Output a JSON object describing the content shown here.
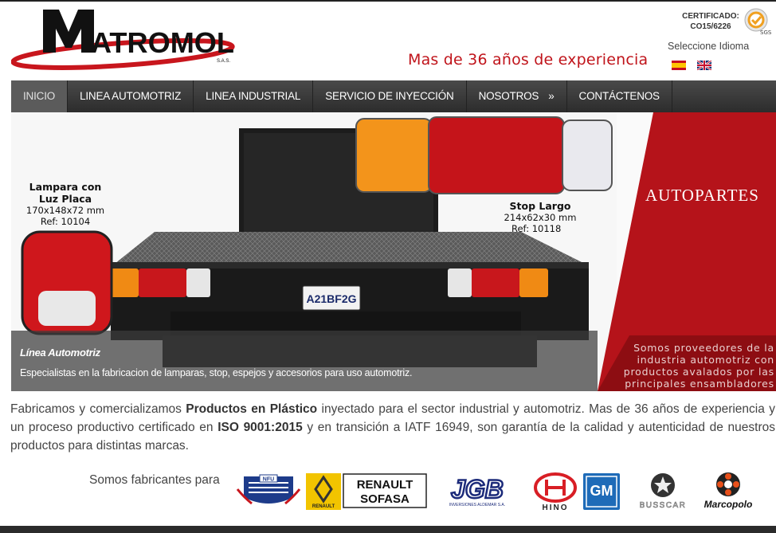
{
  "header": {
    "logo_text": "MATROMOL",
    "logo_sub": "S.A.S.",
    "tagline": "Mas de 36 años de experiencia",
    "cert_label": "CERTIFICADO:",
    "cert_code": "CO15/6226",
    "cert_badge_text": "SGS",
    "language_label": "Seleccione Idioma",
    "flags": [
      "spanish-flag",
      "english-flag"
    ]
  },
  "nav": {
    "items": [
      {
        "label": "INICIO"
      },
      {
        "label": "LINEA AUTOMOTRIZ"
      },
      {
        "label": "LINEA INDUSTRIAL"
      },
      {
        "label": "SERVICIO DE INYECCIÓN"
      },
      {
        "label": "NOSOTROS",
        "arrow": "»"
      },
      {
        "label": "CONTÁCTENOS"
      }
    ]
  },
  "banner": {
    "left_product": {
      "title1": "Lampara con",
      "title2": "Luz Placa",
      "size": "170x148x72 mm",
      "ref": "Ref: 10104"
    },
    "right_product": {
      "title": "Stop Largo",
      "size": "214x62x30 mm",
      "ref": "Ref: 10118"
    },
    "plate": "A21BF2G",
    "red_title": "AUTOPARTES",
    "red_caption": "Somos proveedores de la industria automotriz con productos avalados por las principales ensambladores",
    "caption_title": "Línea Automotriz",
    "caption_text": "Especialistas en la fabricacion de lamparas, stop, espejos y accesorios para uso automotriz."
  },
  "intro": {
    "p1": "Fabricamos y comercializamos ",
    "b1": "Productos en Plástico",
    "p2": " inyectado para el sector industrial y automotriz. Mas de 36 años de experiencia y un proceso productivo certificado en ",
    "b2": "ISO 9001:2015",
    "p3": " y en transición a IATF 16949, son garantía de la calidad y autenticidad de nuestros productos para distintas marcas."
  },
  "makers": {
    "label": "Somos fabricantes para",
    "brands": {
      "nfu": "NFU",
      "renault": "RENAULT",
      "sofasa1": "RENAULT",
      "sofasa2": "SOFASA",
      "jgb": "JGB",
      "jgb_sub": "INVERSIONES ALDEMAR S.A.",
      "hino": "HINO",
      "gm": "GM",
      "busscar": "BUSSCAR",
      "marcopolo": "Marcopolo"
    }
  },
  "colors": {
    "brand_red": "#c0141b",
    "nav_bg": "#3a3a3a",
    "panel_red": "#b5131a"
  }
}
